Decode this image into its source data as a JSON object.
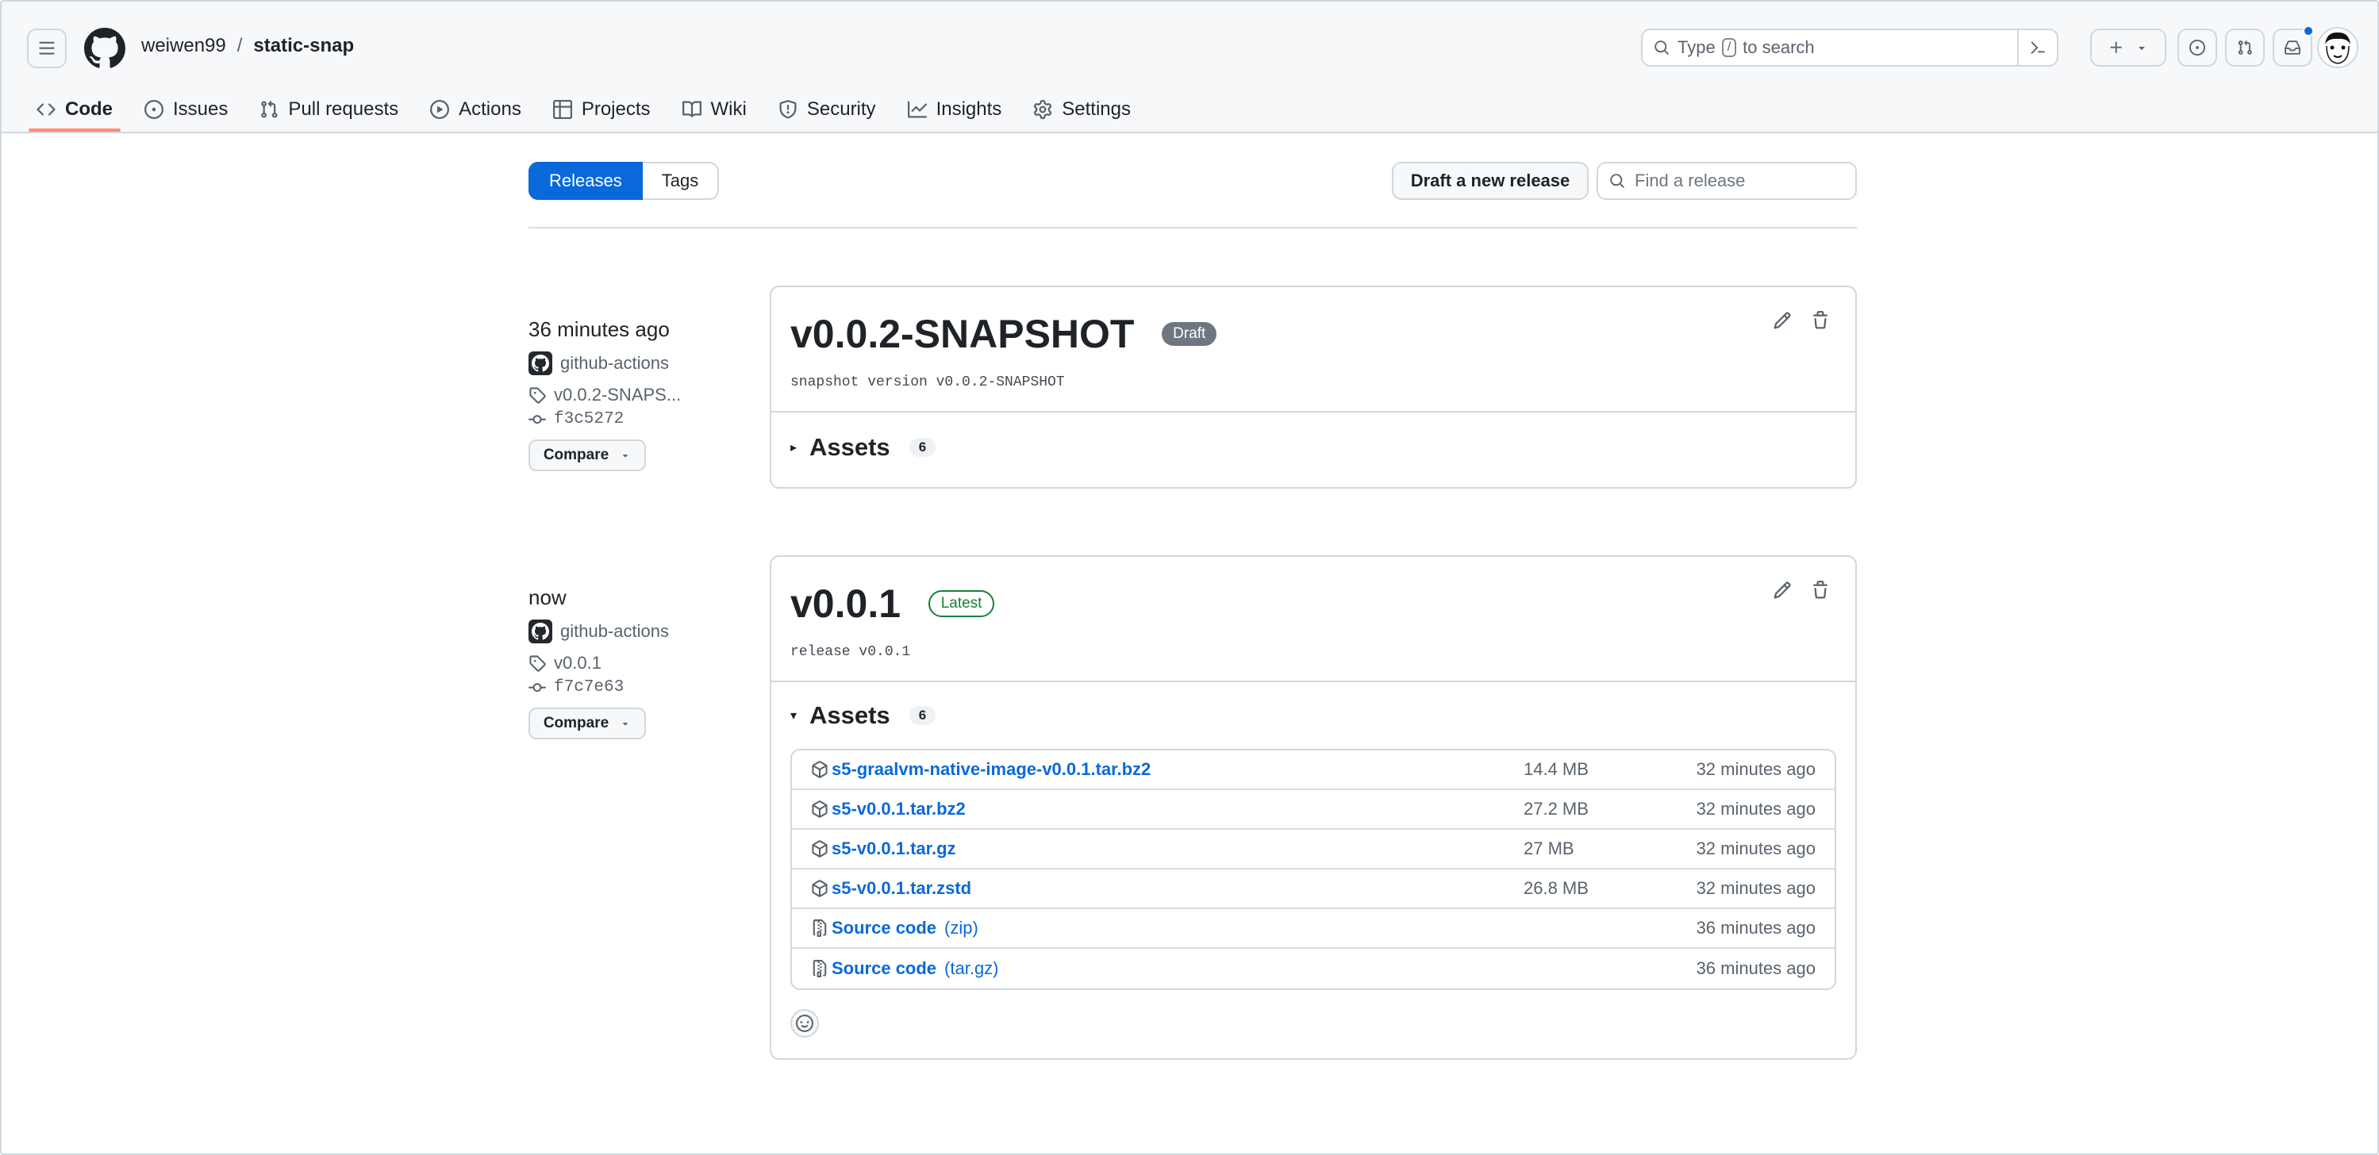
{
  "header": {
    "owner": "weiwen99",
    "separator": "/",
    "repo": "static-snap",
    "search_prefix": "Type",
    "search_key": "/",
    "search_suffix": "to search"
  },
  "tabs": [
    {
      "label": "Code",
      "icon": "code-icon",
      "active": true
    },
    {
      "label": "Issues",
      "icon": "issue-icon"
    },
    {
      "label": "Pull requests",
      "icon": "pull-request-icon"
    },
    {
      "label": "Actions",
      "icon": "play-icon"
    },
    {
      "label": "Projects",
      "icon": "table-icon"
    },
    {
      "label": "Wiki",
      "icon": "book-icon"
    },
    {
      "label": "Security",
      "icon": "shield-icon"
    },
    {
      "label": "Insights",
      "icon": "graph-icon"
    },
    {
      "label": "Settings",
      "icon": "gear-icon"
    }
  ],
  "subnav": {
    "releases": "Releases",
    "tags": "Tags",
    "draft_button": "Draft a new release",
    "find_placeholder": "Find a release"
  },
  "releases": [
    {
      "when": "36 minutes ago",
      "author": "github-actions",
      "tag": "v0.0.2-SNAPS...",
      "commit": "f3c5272",
      "compare": "Compare",
      "title": "v0.0.2-SNAPSHOT",
      "badge": "Draft",
      "description": "snapshot version v0.0.2-SNAPSHOT",
      "assets_label": "Assets",
      "assets_count": "6",
      "assets_caret": "▸"
    },
    {
      "when": "now",
      "author": "github-actions",
      "tag": "v0.0.1",
      "commit": "f7c7e63",
      "compare": "Compare",
      "title": "v0.0.1",
      "badge": "Latest",
      "description": "release v0.0.1",
      "assets_label": "Assets",
      "assets_count": "6",
      "assets_caret": "▾",
      "assets": [
        {
          "name": "s5-graalvm-native-image-v0.0.1.tar.bz2",
          "suffix": "",
          "size": "14.4 MB",
          "date": "32 minutes ago",
          "icon": "package-icon"
        },
        {
          "name": "s5-v0.0.1.tar.bz2",
          "suffix": "",
          "size": "27.2 MB",
          "date": "32 minutes ago",
          "icon": "package-icon"
        },
        {
          "name": "s5-v0.0.1.tar.gz",
          "suffix": "",
          "size": "27 MB",
          "date": "32 minutes ago",
          "icon": "package-icon"
        },
        {
          "name": "s5-v0.0.1.tar.zstd",
          "suffix": "",
          "size": "26.8 MB",
          "date": "32 minutes ago",
          "icon": "package-icon"
        },
        {
          "name": "Source code",
          "suffix": "(zip)",
          "size": "",
          "date": "36 minutes ago",
          "icon": "file-zip-icon"
        },
        {
          "name": "Source code",
          "suffix": "(tar.gz)",
          "size": "",
          "date": "36 minutes ago",
          "icon": "file-zip-icon"
        }
      ]
    }
  ],
  "colors": {
    "accent": "#0969da",
    "tab_underline": "#fd8c73",
    "latest_green": "#1a7f37",
    "draft_gray": "#6e7781"
  }
}
